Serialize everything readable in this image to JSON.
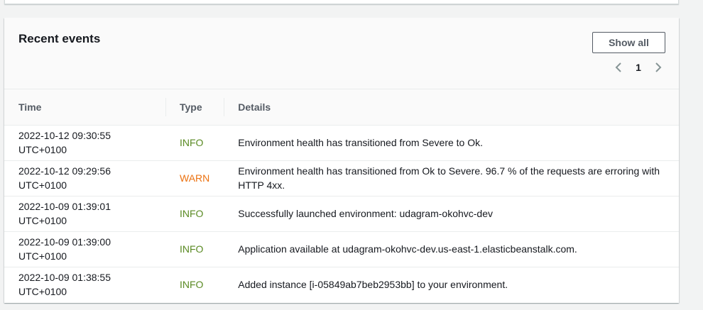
{
  "panel": {
    "title": "Recent events",
    "show_all_label": "Show all",
    "pagination": {
      "current_page": "1"
    }
  },
  "table": {
    "headers": {
      "time": "Time",
      "type": "Type",
      "details": "Details"
    },
    "rows": [
      {
        "time_line1": "2022-10-12 09:30:55",
        "time_line2": "UTC+0100",
        "type": "INFO",
        "details": "Environment health has transitioned from Severe to Ok."
      },
      {
        "time_line1": "2022-10-12 09:29:56",
        "time_line2": "UTC+0100",
        "type": "WARN",
        "details": "Environment health has transitioned from Ok to Severe. 96.7 % of the requests are erroring with HTTP 4xx."
      },
      {
        "time_line1": "2022-10-09 01:39:01",
        "time_line2": "UTC+0100",
        "type": "INFO",
        "details": "Successfully launched environment: udagram-okohvc-dev"
      },
      {
        "time_line1": "2022-10-09 01:39:00",
        "time_line2": "UTC+0100",
        "type": "INFO",
        "details": "Application available at udagram-okohvc-dev.us-east-1.elasticbeanstalk.com."
      },
      {
        "time_line1": "2022-10-09 01:38:55",
        "time_line2": "UTC+0100",
        "type": "INFO",
        "details": "Added instance [i-05849ab7beb2953bb] to your environment."
      }
    ]
  },
  "colors": {
    "info": "#5a8a23",
    "warn": "#ec7211"
  },
  "icons": {
    "prev": "chevron-left-icon",
    "next": "chevron-right-icon"
  }
}
